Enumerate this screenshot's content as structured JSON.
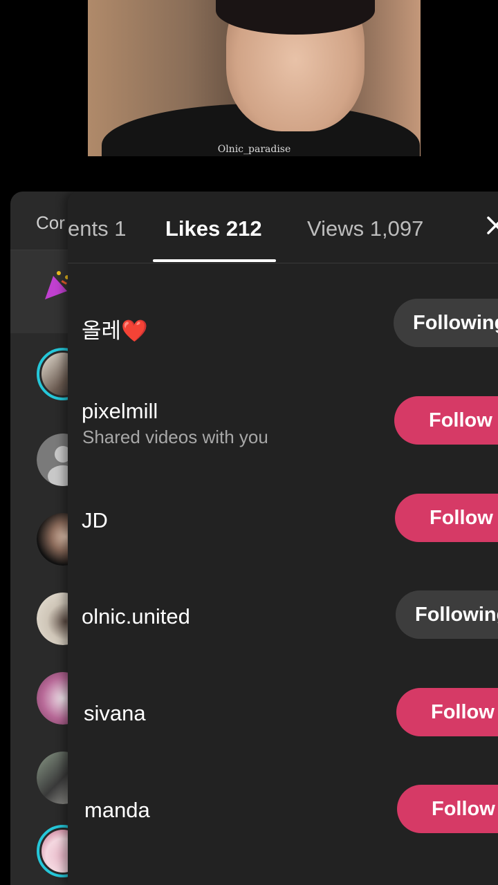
{
  "video": {
    "watermark": "Olnic_paradise"
  },
  "back_panel": {
    "tab_label": "Cor"
  },
  "tabs": {
    "comments_label": "ents 1",
    "likes_label": "Likes 212",
    "views_label": "Views 1,097",
    "close_icon": "close-icon"
  },
  "likes_list": [
    {
      "name": "올레❤️",
      "subtitle": "",
      "button": "Following"
    },
    {
      "name": "pixelmill",
      "subtitle": "Shared videos with you",
      "button": "Follow"
    },
    {
      "name": "JD",
      "subtitle": "",
      "button": "Follow"
    },
    {
      "name": "olnic.united",
      "subtitle": "",
      "button": "Following"
    },
    {
      "name": "sivana",
      "subtitle": "",
      "button": "Follow"
    },
    {
      "name": "manda",
      "subtitle": "",
      "button": "Follow"
    }
  ],
  "colors": {
    "follow": "#d63a66",
    "following": "#3d3d3d",
    "panel": "#222222",
    "ring": "#25c7d9"
  }
}
